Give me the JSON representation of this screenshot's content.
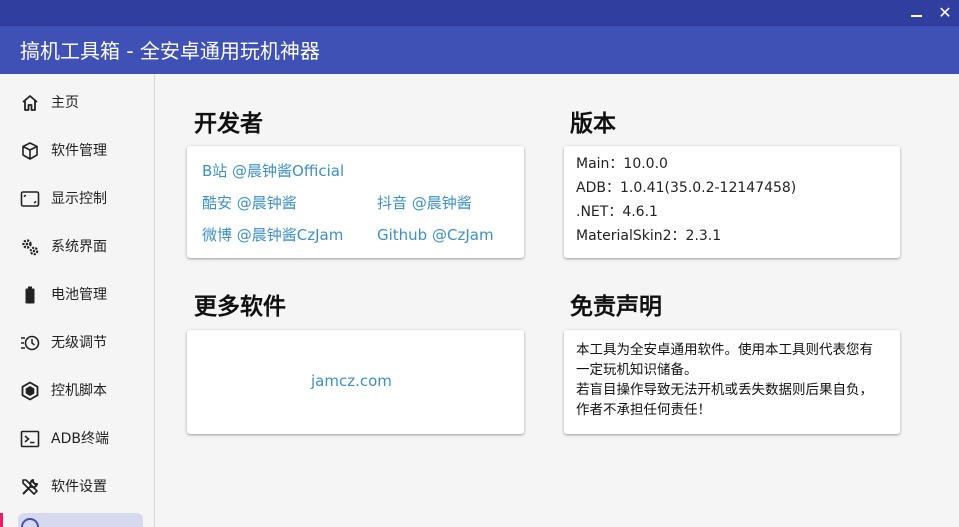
{
  "window": {
    "title": "搞机工具箱 - 全安卓通用玩机神器",
    "minimize_glyph": "",
    "close_glyph": "✕"
  },
  "sidebar": {
    "items": [
      {
        "label": "主页",
        "icon": "home-icon"
      },
      {
        "label": "软件管理",
        "icon": "package-icon"
      },
      {
        "label": "显示控制",
        "icon": "display-icon"
      },
      {
        "label": "系统界面",
        "icon": "gears-icon"
      },
      {
        "label": "电池管理",
        "icon": "battery-icon"
      },
      {
        "label": "无级调节",
        "icon": "slider-icon"
      },
      {
        "label": "控机脚本",
        "icon": "hexagon-icon"
      },
      {
        "label": "ADB终端",
        "icon": "terminal-icon"
      },
      {
        "label": "软件设置",
        "icon": "tools-icon"
      }
    ]
  },
  "developer": {
    "title": "开发者",
    "links": [
      "B站 @晨钟酱Official",
      "酷安 @晨钟酱",
      "抖音 @晨钟酱",
      "微博 @晨钟酱CzJam",
      "Github @CzJam"
    ]
  },
  "version": {
    "title": "版本",
    "lines": [
      "Main：10.0.0",
      "ADB：1.0.41(35.0.2-12147458)",
      ".NET：4.6.1",
      "MaterialSkin2：2.3.1"
    ]
  },
  "more_software": {
    "title": "更多软件",
    "link": "jamcz.com"
  },
  "disclaimer": {
    "title": "免责声明",
    "lines": [
      "本工具为全安卓通用软件。使用本工具则代表您有",
      "一定玩机知识储备。",
      "若盲目操作导致无法开机或丢失数据则后果自负，",
      "作者不承担任何责任！"
    ]
  },
  "colors": {
    "titlebar": "#3f51b5",
    "titlebar_strip": "#303f9f",
    "link": "#3f8fc4",
    "active_marker": "#e91e63"
  }
}
